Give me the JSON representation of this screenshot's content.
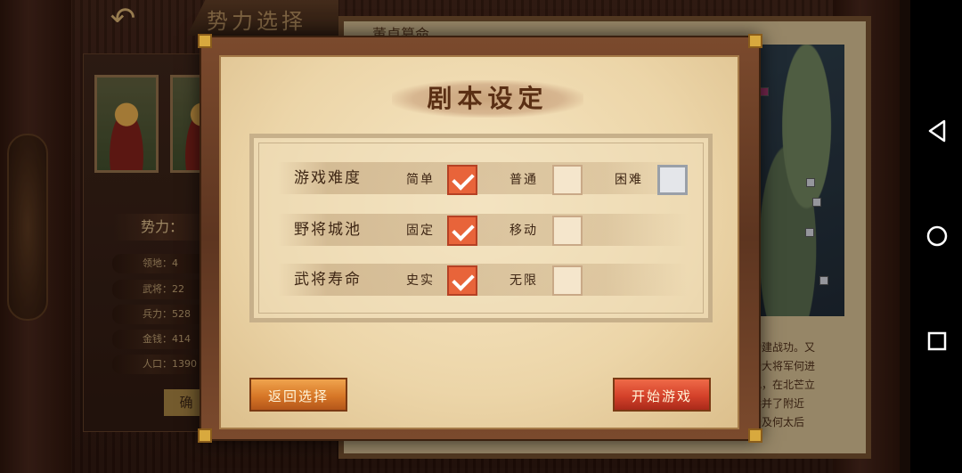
{
  "background": {
    "screen_title": "势力选择",
    "faction_label": "势力：",
    "stats": [
      {
        "label": "领地：",
        "value": "4"
      },
      {
        "label": "武将：",
        "value": "22"
      },
      {
        "label": "兵力：",
        "value": "528"
      },
      {
        "label": "金钱：",
        "value": "414"
      },
      {
        "label": "人口：",
        "value": "1390"
      }
    ],
    "confirm_label": "确",
    "map_title": "董卓篡命",
    "story_text": "功建战功。又\n受大将军何进\n乱，在北芒立\n吞并了附近\n帝及何太后"
  },
  "dialog": {
    "title": "剧本设定",
    "options": [
      {
        "label": "游戏难度",
        "choices": [
          {
            "label": "简单",
            "state": "checked"
          },
          {
            "label": "普通",
            "state": "unchecked"
          },
          {
            "label": "困难",
            "state": "disabled"
          }
        ]
      },
      {
        "label": "野将城池",
        "choices": [
          {
            "label": "固定",
            "state": "checked"
          },
          {
            "label": "移动",
            "state": "unchecked"
          }
        ]
      },
      {
        "label": "武将寿命",
        "choices": [
          {
            "label": "史实",
            "state": "checked"
          },
          {
            "label": "无限",
            "state": "unchecked"
          }
        ]
      }
    ],
    "back_button": "返回选择",
    "start_button": "开始游戏"
  },
  "colors": {
    "checked": "#e8643a",
    "back_button": "#d77727",
    "start_button": "#d4412a"
  },
  "nav_icons": [
    "back-triangle-icon",
    "home-circle-icon",
    "recents-square-icon"
  ]
}
